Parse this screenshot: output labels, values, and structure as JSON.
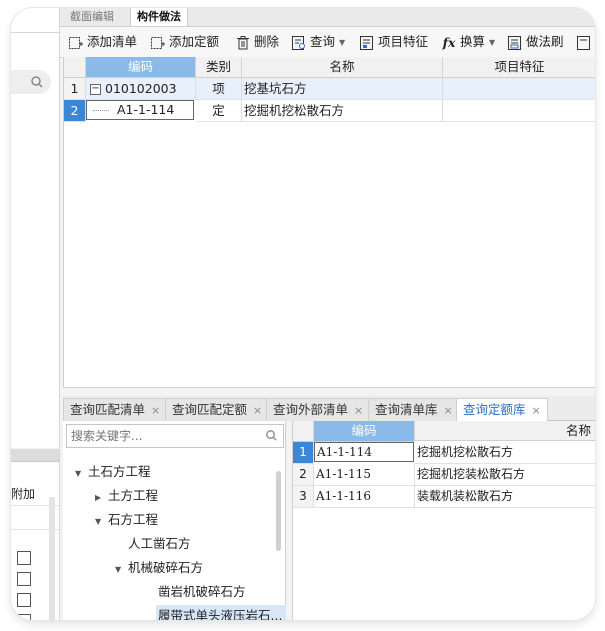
{
  "top_tabs": [
    {
      "label": "截面编辑",
      "active": false
    },
    {
      "label": "构件做法",
      "active": true
    }
  ],
  "toolbar": {
    "add_list": "添加清单",
    "add_quota": "添加定额",
    "delete": "删除",
    "query": "查询",
    "item_feature": "项目特征",
    "convert": "换算",
    "method_brush": "做法刷"
  },
  "left_panel": {
    "attach_label": "附加"
  },
  "upper_grid": {
    "columns": [
      "编码",
      "类别",
      "名称",
      "项目特征"
    ],
    "rows": [
      {
        "num": "1",
        "code": "010102003",
        "type": "项",
        "name": "挖基坑石方",
        "feature": ""
      },
      {
        "num": "2",
        "code": "A1-1-114",
        "type": "定",
        "name": "挖掘机挖松散石方",
        "feature": ""
      }
    ]
  },
  "bottom_tabs": [
    {
      "label": "查询匹配清单",
      "close": "×"
    },
    {
      "label": "查询匹配定额",
      "close": "×"
    },
    {
      "label": "查询外部清单",
      "close": "×"
    },
    {
      "label": "查询清单库",
      "close": "×"
    },
    {
      "label": "查询定额库",
      "close": "×"
    }
  ],
  "tree": {
    "search_placeholder": "搜索关键字...",
    "nodes": [
      {
        "label": "土石方工程",
        "toggle": "▼"
      },
      {
        "label": "土方工程",
        "toggle": "▶"
      },
      {
        "label": "石方工程",
        "toggle": "▼"
      },
      {
        "label": "人工凿石方",
        "toggle": ""
      },
      {
        "label": "机械破碎石方",
        "toggle": "▼"
      },
      {
        "label": "凿岩机破碎石方",
        "toggle": ""
      },
      {
        "label": "履带式单头液压岩石...",
        "toggle": ""
      }
    ]
  },
  "result_grid": {
    "columns": [
      "编码",
      "名称"
    ],
    "rows": [
      {
        "num": "1",
        "code": "A1-1-114",
        "name": "挖掘机挖松散石方"
      },
      {
        "num": "2",
        "code": "A1-1-115",
        "name": "挖掘机挖装松散石方"
      },
      {
        "num": "3",
        "code": "A1-1-116",
        "name": "装载机装松散石方"
      }
    ]
  },
  "colors": {
    "accent": "#3b86d6",
    "header_selected": "#8bb9e8",
    "row_highlight": "#e8f1fb"
  }
}
